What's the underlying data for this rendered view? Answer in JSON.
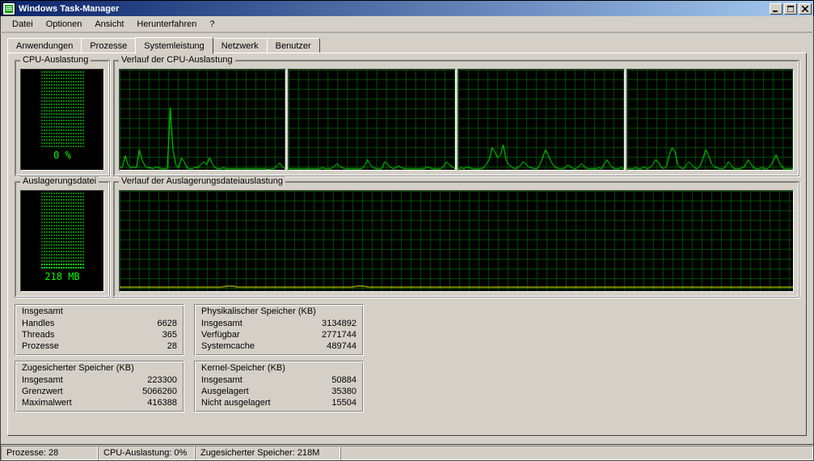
{
  "title": "Windows Task-Manager",
  "menu": [
    "Datei",
    "Optionen",
    "Ansicht",
    "Herunterfahren",
    "?"
  ],
  "tabs": [
    "Anwendungen",
    "Prozesse",
    "Systemleistung",
    "Netzwerk",
    "Benutzer"
  ],
  "active_tab": 2,
  "panels": {
    "cpu": {
      "title": "CPU-Auslastung",
      "value_label": "0 %"
    },
    "cpu_history": {
      "title": "Verlauf der CPU-Auslastung"
    },
    "pagefile": {
      "title": "Auslagerungsdatei",
      "value_label": "218 MB"
    },
    "pf_history": {
      "title": "Verlauf der Auslagerungsdateiauslastung"
    }
  },
  "stats": {
    "totals": {
      "title": "Insgesamt",
      "rows": [
        {
          "label": "Handles",
          "value": "6628"
        },
        {
          "label": "Threads",
          "value": "365"
        },
        {
          "label": "Prozesse",
          "value": "28"
        }
      ]
    },
    "physmem": {
      "title": "Physikalischer Speicher (KB)",
      "rows": [
        {
          "label": "Insgesamt",
          "value": "3134892"
        },
        {
          "label": "Verfügbar",
          "value": "2771744"
        },
        {
          "label": "Systemcache",
          "value": "489744"
        }
      ]
    },
    "commit": {
      "title": "Zugesicherter Speicher (KB)",
      "rows": [
        {
          "label": "Insgesamt",
          "value": "223300"
        },
        {
          "label": "Grenzwert",
          "value": "5066260"
        },
        {
          "label": "Maximalwert",
          "value": "416388"
        }
      ]
    },
    "kernel": {
      "title": "Kernel-Speicher (KB)",
      "rows": [
        {
          "label": "Insgesamt",
          "value": "50884"
        },
        {
          "label": "Ausgelagert",
          "value": "35380"
        },
        {
          "label": "Nicht ausgelagert",
          "value": "15504"
        }
      ]
    }
  },
  "statusbar": {
    "processes": "Prozesse: 28",
    "cpu": "CPU-Auslastung: 0%",
    "commit": "Zugesicherter Speicher: 218M"
  },
  "chart_data": [
    {
      "type": "area",
      "name": "cpu0",
      "ylim": [
        0,
        100
      ],
      "ylabel": "CPU %",
      "values": [
        2,
        3,
        14,
        5,
        2,
        3,
        2,
        20,
        10,
        4,
        2,
        2,
        1,
        3,
        2,
        1,
        1,
        1,
        62,
        20,
        5,
        2,
        12,
        8,
        2,
        1,
        1,
        3,
        2,
        6,
        8,
        5,
        12,
        6,
        2,
        1,
        1,
        2,
        1,
        1,
        1,
        1,
        1,
        1,
        1,
        1,
        1,
        1,
        1,
        1,
        1,
        1,
        1,
        0,
        1,
        1,
        4,
        7,
        3,
        1
      ]
    },
    {
      "type": "area",
      "name": "cpu1",
      "ylim": [
        0,
        100
      ],
      "ylabel": "CPU %",
      "values": [
        1,
        1,
        1,
        1,
        1,
        1,
        1,
        1,
        1,
        1,
        1,
        1,
        2,
        1,
        1,
        1,
        3,
        6,
        4,
        2,
        1,
        1,
        1,
        1,
        1,
        1,
        1,
        5,
        10,
        5,
        2,
        1,
        1,
        1,
        8,
        6,
        3,
        1,
        2,
        4,
        2,
        1,
        1,
        1,
        1,
        1,
        1,
        1,
        1,
        3,
        2,
        1,
        1,
        1,
        1,
        4,
        8,
        5,
        3,
        1
      ]
    },
    {
      "type": "area",
      "name": "cpu2",
      "ylim": [
        0,
        100
      ],
      "ylabel": "CPU %",
      "values": [
        1,
        2,
        1,
        3,
        2,
        1,
        1,
        1,
        1,
        2,
        6,
        10,
        22,
        18,
        12,
        15,
        25,
        10,
        5,
        3,
        1,
        2,
        4,
        8,
        6,
        3,
        2,
        1,
        1,
        5,
        12,
        20,
        15,
        8,
        4,
        2,
        1,
        1,
        2,
        5,
        3,
        1,
        1,
        4,
        6,
        3,
        1,
        1,
        1,
        1,
        2,
        1,
        6,
        10,
        5,
        2,
        1,
        1,
        2,
        1
      ]
    },
    {
      "type": "area",
      "name": "cpu3",
      "ylim": [
        0,
        100
      ],
      "ylabel": "CPU %",
      "values": [
        1,
        1,
        1,
        2,
        1,
        1,
        3,
        1,
        2,
        5,
        10,
        8,
        3,
        1,
        4,
        15,
        22,
        18,
        5,
        2,
        1,
        5,
        8,
        5,
        2,
        1,
        4,
        12,
        20,
        14,
        6,
        3,
        2,
        1,
        1,
        3,
        8,
        5,
        1,
        1,
        1,
        2,
        4,
        10,
        6,
        2,
        1,
        1,
        2,
        1,
        1,
        4,
        9,
        15,
        8,
        3,
        1,
        1,
        1,
        1
      ]
    },
    {
      "type": "line",
      "name": "pagefile_history",
      "ylim": [
        0,
        100
      ],
      "ylabel": "PF usage %",
      "values": [
        4,
        4,
        4,
        4,
        4,
        4,
        4,
        4,
        4,
        4,
        4,
        4,
        4,
        4,
        4,
        4,
        4,
        4,
        4,
        5,
        5,
        4,
        4,
        4,
        4,
        4,
        4,
        4,
        4,
        4,
        4,
        4,
        4,
        4,
        4,
        4,
        4,
        4,
        4,
        4,
        4,
        4,
        5,
        5,
        4,
        4,
        4,
        4,
        4,
        4,
        4,
        4,
        4,
        4,
        4,
        4,
        4,
        4,
        4,
        4,
        4,
        4,
        4,
        4,
        4,
        4,
        4,
        4,
        4,
        4,
        4,
        4,
        4,
        4,
        4,
        4,
        4,
        4,
        4,
        4,
        4,
        4,
        4,
        4,
        4,
        4,
        4,
        4,
        4,
        4,
        4,
        4,
        4,
        4,
        4,
        4,
        4,
        4,
        4,
        4,
        4,
        4,
        4,
        4,
        4,
        4,
        4,
        4,
        4,
        4,
        4,
        4,
        4,
        4,
        4,
        4,
        4,
        4,
        4,
        4
      ]
    }
  ]
}
